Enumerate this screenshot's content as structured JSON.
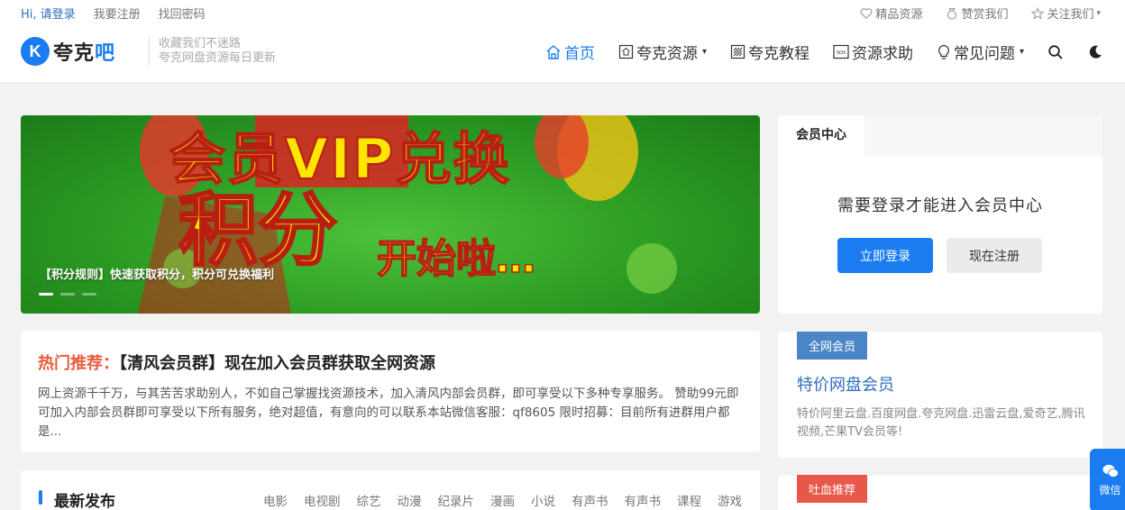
{
  "topbar": {
    "hi_login": "Hi, 请登录",
    "register": "我要注册",
    "recover": "找回密码",
    "premium": "精品资源",
    "donate": "赞赏我们",
    "follow": "关注我们"
  },
  "header": {
    "logo_text": "夸克",
    "logo_suffix": "吧",
    "logo_letter": "K",
    "slogan_line1": "收藏我们不迷路",
    "slogan_line2": "夸克网盘资源每日更新"
  },
  "nav": {
    "items": [
      {
        "label": "首页",
        "icon": "home-icon",
        "active": true,
        "dropdown": false
      },
      {
        "label": "夸克资源",
        "icon": "resource-icon",
        "active": false,
        "dropdown": true
      },
      {
        "label": "夸克教程",
        "icon": "tutorial-icon",
        "active": false,
        "dropdown": false
      },
      {
        "label": "资源求助",
        "icon": "sos-icon",
        "active": false,
        "dropdown": false
      },
      {
        "label": "常见问题",
        "icon": "bulb-icon",
        "active": false,
        "dropdown": true
      }
    ],
    "search_icon": "search-icon",
    "theme_icon": "moon-icon"
  },
  "banner": {
    "text_main": "会员VIP兑换",
    "text_big": "积分",
    "text_sub": "开始啦…",
    "caption": "【积分规则】快速获取积分，积分可兑换福利",
    "active_slide": 1,
    "slide_count": 3
  },
  "hot": {
    "tag": "热门推荐：",
    "title": "【清风会员群】现在加入会员群获取全网资源",
    "desc": "网上资源千千万，与其苦苦求助别人，不如自己掌握找资源技术，加入清风内部会员群，即可享受以下多种专享服务。 赞助99元即可加入内部会员群即可享受以下所有服务，绝对超值，有意向的可以联系本站微信客服：qf8605 限时招募：目前所有进群用户都是..."
  },
  "latest": {
    "heading": "最新发布",
    "categories": [
      "电影",
      "电视剧",
      "综艺",
      "动漫",
      "纪录片",
      "漫画",
      "小说",
      "有声书",
      "有声书",
      "课程",
      "游戏"
    ]
  },
  "member": {
    "tab": "会员中心",
    "need_login": "需要登录才能进入会员中心",
    "login_btn": "立即登录",
    "register_btn": "现在注册"
  },
  "promo": {
    "label": "全网会员",
    "title": "特价网盘会员",
    "desc": "特价阿里云盘.百度网盘.夸克网盘.迅雷云盘,爱奇艺,腾讯视频,芒果TV会员等!"
  },
  "hotcard": {
    "label": "吐血推荐"
  },
  "wechat": {
    "label": "微信"
  },
  "colors": {
    "accent": "#1a7cf0",
    "hot_tag": "#e85b3d",
    "promo_label": "#4a86c5",
    "hot_label": "#e8584a",
    "banner_green": "#2a9a22"
  }
}
